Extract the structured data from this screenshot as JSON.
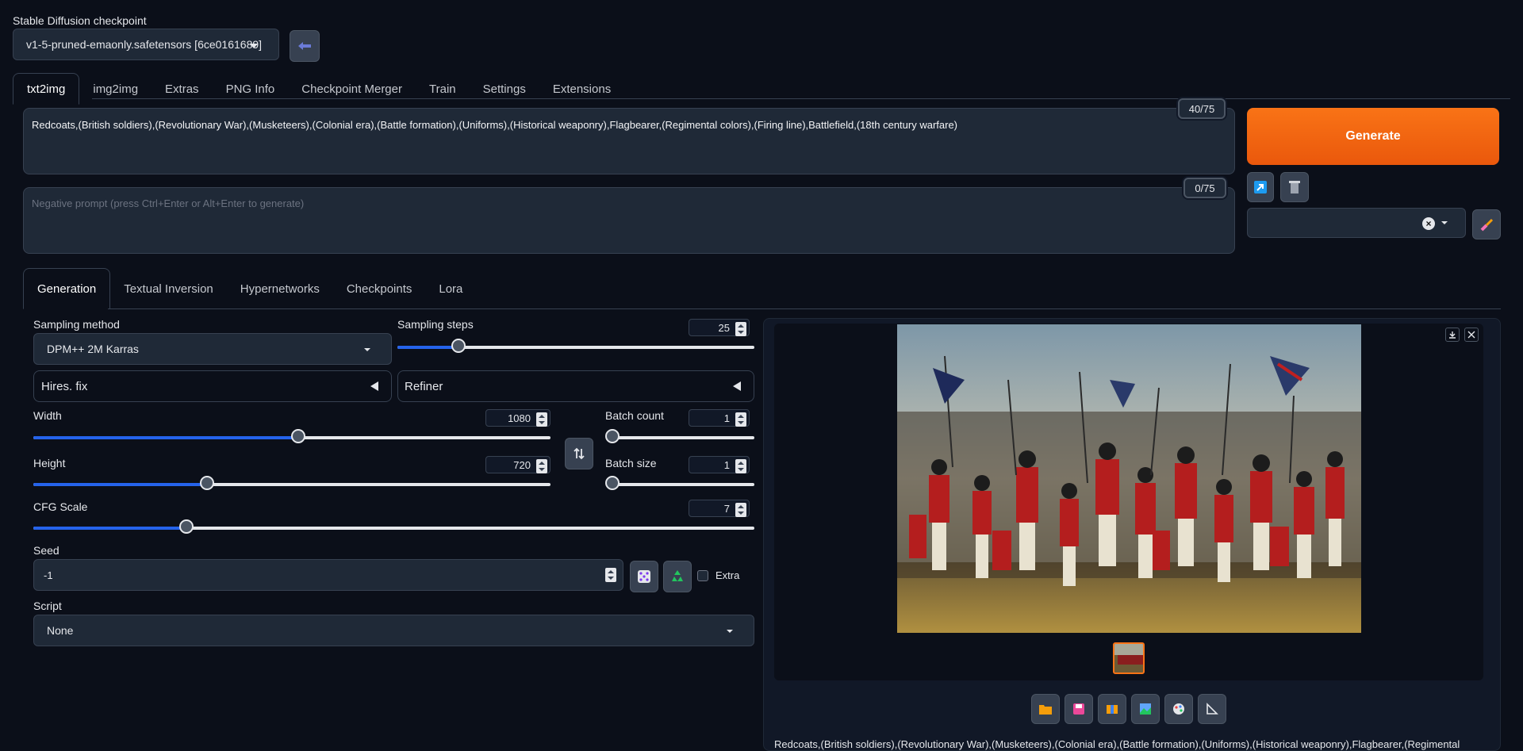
{
  "checkpoint": {
    "label": "Stable Diffusion checkpoint",
    "value": "v1-5-pruned-emaonly.safetensors [6ce0161689]"
  },
  "main_tabs": [
    "txt2img",
    "img2img",
    "Extras",
    "PNG Info",
    "Checkpoint Merger",
    "Train",
    "Settings",
    "Extensions"
  ],
  "prompt": {
    "value": "Redcoats,(British soldiers),(Revolutionary War),(Musketeers),(Colonial era),(Battle formation),(Uniforms),(Historical weaponry),Flagbearer,(Regimental colors),(Firing line),Battlefield,(18th century warfare)",
    "token_count": "40/75"
  },
  "negative_prompt": {
    "placeholder": "Negative prompt (press Ctrl+Enter or Alt+Enter to generate)",
    "token_count": "0/75"
  },
  "generate_label": "Generate",
  "sub_tabs": [
    "Generation",
    "Textual Inversion",
    "Hypernetworks",
    "Checkpoints",
    "Lora"
  ],
  "sampling_method": {
    "label": "Sampling method",
    "value": "DPM++ 2M Karras"
  },
  "sampling_steps": {
    "label": "Sampling steps",
    "value": "25",
    "fraction": 0.17
  },
  "hires": {
    "label": "Hires. fix"
  },
  "refiner": {
    "label": "Refiner"
  },
  "width": {
    "label": "Width",
    "value": "1080",
    "fraction": 0.513
  },
  "height": {
    "label": "Height",
    "value": "720",
    "fraction": 0.336
  },
  "batch_count": {
    "label": "Batch count",
    "value": "1",
    "fraction": 0
  },
  "batch_size": {
    "label": "Batch size",
    "value": "1",
    "fraction": 0
  },
  "cfg": {
    "label": "CFG Scale",
    "value": "7",
    "fraction": 0.212
  },
  "seed": {
    "label": "Seed",
    "value": "-1",
    "extra_label": "Extra"
  },
  "script": {
    "label": "Script",
    "value": "None"
  },
  "output_caption": "Redcoats,(British soldiers),(Revolutionary War),(Musketeers),(Colonial era),(Battle formation),(Uniforms),(Historical weaponry),Flagbearer,(Regimental",
  "icons": {
    "refresh": "refresh-checkpoint-icon",
    "read_params": "arrow-up-left-icon",
    "trash": "trash-icon",
    "clear": "x-icon",
    "brush": "paintbrush-icon",
    "swap": "swap-dimensions-icon",
    "dice": "dice-icon",
    "recycle": "recycle-icon",
    "download": "download-icon",
    "close": "close-icon",
    "toolbar": [
      "folder-icon",
      "save-icon",
      "zip-icon",
      "send-to-img2img-icon",
      "send-to-inpaint-icon",
      "send-to-extras-icon"
    ]
  },
  "colors": {
    "accent": "#ea580c",
    "slider": "#2563eb",
    "background": "#0b0f19",
    "panel": "#1f2937"
  }
}
